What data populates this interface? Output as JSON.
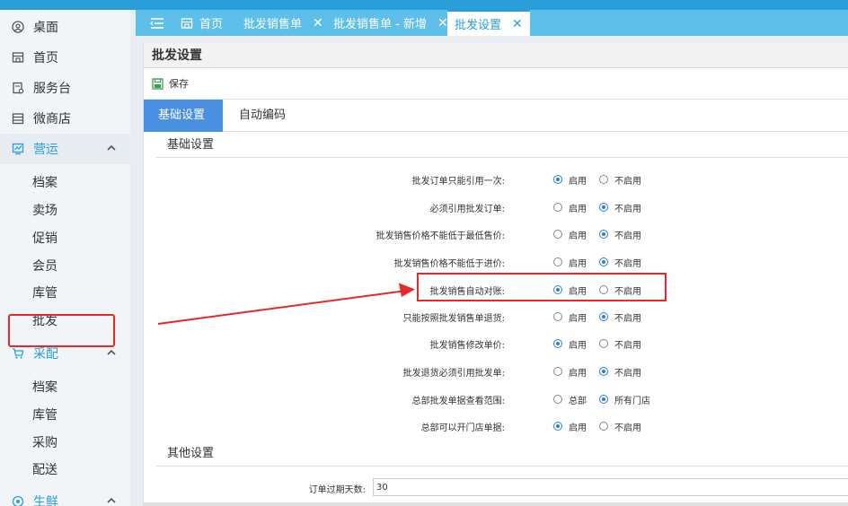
{
  "sidebar": {
    "items": [
      {
        "label": "桌面",
        "icon": "desktop-icon"
      },
      {
        "label": "首页",
        "icon": "home-icon"
      },
      {
        "label": "服务台",
        "icon": "service-desk-icon"
      },
      {
        "label": "微商店",
        "icon": "shop-icon"
      }
    ],
    "groups": [
      {
        "label": "营运",
        "icon": "operations-icon",
        "subs": [
          "档案",
          "卖场",
          "促销",
          "会员",
          "库管",
          "批发"
        ]
      },
      {
        "label": "采配",
        "icon": "cart-icon",
        "subs": [
          "档案",
          "库管",
          "采购",
          "配送"
        ]
      },
      {
        "label": "生鲜",
        "icon": "fresh-icon",
        "subs": []
      }
    ]
  },
  "tabs": [
    {
      "label": "首页"
    },
    {
      "label": "批发销售单"
    },
    {
      "label": "批发销售单 - 新增"
    },
    {
      "label": "批发设置"
    }
  ],
  "tab_close": "✕",
  "panel": {
    "title": "批发设置",
    "save_label": "保存",
    "subtabs": [
      "基础设置",
      "自动编码"
    ],
    "section_basic": "基础设置",
    "section_other": "其他设置"
  },
  "settings": [
    {
      "label": "批发订单只能引用一次:",
      "opt1": "启用",
      "opt2": "不启用",
      "selected": 1
    },
    {
      "label": "必须引用批发订单:",
      "opt1": "启用",
      "opt2": "不启用",
      "selected": 2
    },
    {
      "label": "批发销售价格不能低于最低售价:",
      "opt1": "启用",
      "opt2": "不启用",
      "selected": 2
    },
    {
      "label": "批发销售价格不能低于进价:",
      "opt1": "启用",
      "opt2": "不启用",
      "selected": 2
    },
    {
      "label": "批发销售自动对账:",
      "opt1": "启用",
      "opt2": "不启用",
      "selected": 1
    },
    {
      "label": "只能按照批发销售单退货:",
      "opt1": "启用",
      "opt2": "不启用",
      "selected": 2
    },
    {
      "label": "批发销售修改单价:",
      "opt1": "启用",
      "opt2": "不启用",
      "selected": 1
    },
    {
      "label": "批发退货必须引用批发单:",
      "opt1": "启用",
      "opt2": "不启用",
      "selected": 2
    },
    {
      "label": "总部批发单据查看范围:",
      "opt1": "总部",
      "opt2": "所有门店",
      "selected": 2
    },
    {
      "label": "总部可以开门店单据:",
      "opt1": "启用",
      "opt2": "不启用",
      "selected": 1
    }
  ],
  "order_expiry": {
    "label": "订单过期天数:",
    "value": "30"
  },
  "colors": {
    "accent": "#2a9ed8",
    "highlight": "#e8272b"
  }
}
